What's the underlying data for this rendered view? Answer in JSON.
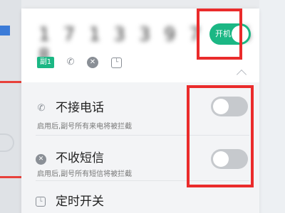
{
  "app": {
    "sim_badge": "副1",
    "power_toggle": {
      "label": "开机",
      "state": "on"
    },
    "icons": [
      "call-blocked-icon",
      "message-blocked-icon",
      "clock-icon",
      "chevron-up-icon"
    ]
  },
  "settings": {
    "block_calls": {
      "title": "不接电话",
      "description": "启用后,副号所有来电将被拦截",
      "state": "off"
    },
    "block_sms": {
      "title": "不收短信",
      "description": "启用后,副号所有短信将被拦截",
      "state": "off"
    },
    "scheduled_power": {
      "title": "定时开关"
    }
  },
  "colors": {
    "accent": "#1bb784",
    "highlight": "#ea2b2b",
    "toggle_off": "#c6c9cd"
  }
}
